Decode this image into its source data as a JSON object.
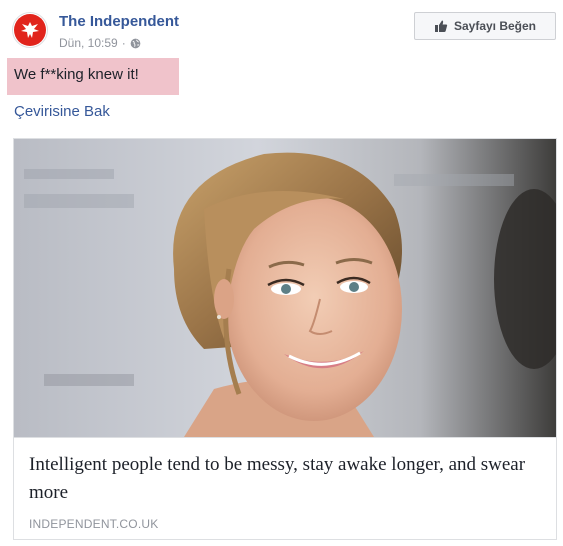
{
  "post": {
    "page_name": "The Independent",
    "timestamp": "Dün, 10:59",
    "separator": "·",
    "text": "We f**king knew it!",
    "translate_label": "Çevirisine Bak",
    "like_page_label": "Sayfayı Beğen"
  },
  "link": {
    "headline": "Intelligent people tend to be messy, stay awake longer, and swear more",
    "domain": "INDEPENDENT.CO.UK"
  },
  "icons": {
    "avatar": "independent-eagle-logo",
    "privacy": "globe-icon",
    "like": "thumbs-up-icon"
  },
  "colors": {
    "link_blue": "#365899",
    "meta_gray": "#90949c",
    "highlight_pink": "#f0c3cb",
    "brand_red": "#e1241c"
  }
}
